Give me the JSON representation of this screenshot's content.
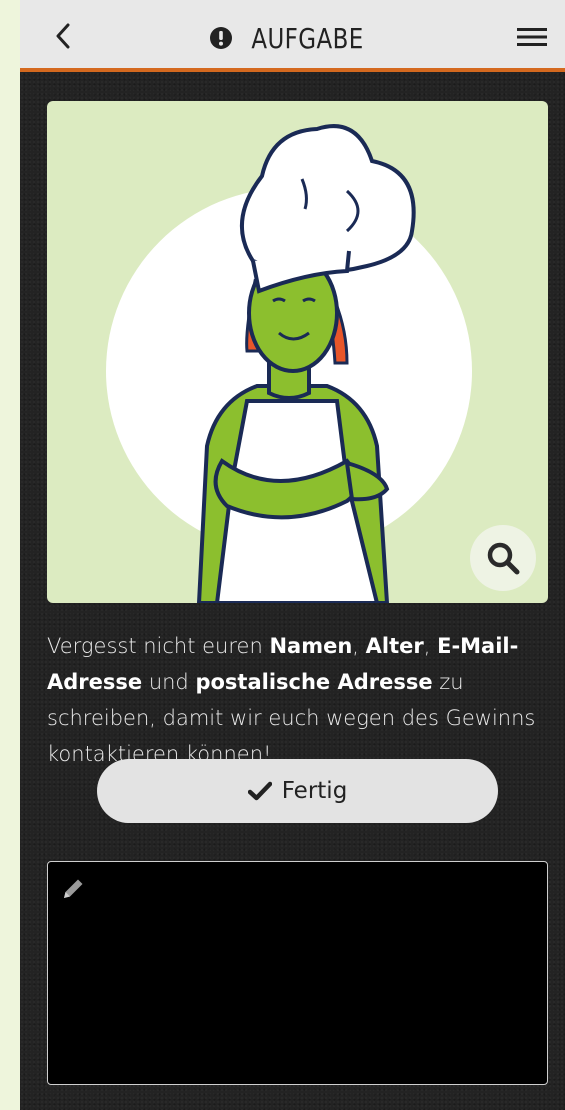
{
  "header": {
    "title": "AUFGABE",
    "back_icon": "chevron-left-icon",
    "title_icon": "exclamation-circle-icon",
    "menu_icon": "hamburger-menu-icon"
  },
  "image": {
    "zoom_icon": "magnifier-icon",
    "background": "#dcebc1"
  },
  "task": {
    "text_parts": [
      "Vergesst nicht euren ",
      "Namen",
      ", ",
      "Alter",
      ", ",
      "E-Mail-Adresse",
      " und ",
      "postalische Adresse",
      " zu schreiben, damit wir euch wegen des Gewinns kontaktieren können!"
    ]
  },
  "done_button": {
    "label": "Fertig",
    "icon": "checkmark-icon"
  },
  "answer": {
    "icon": "pencil-icon",
    "value": ""
  },
  "colors": {
    "accent": "#d4691f",
    "header_bg": "#e8e8e8",
    "page_bg": "#232323",
    "outer_bg": "#eef5dc"
  }
}
